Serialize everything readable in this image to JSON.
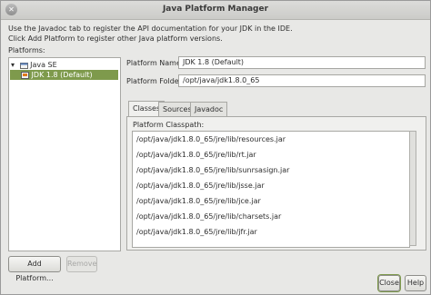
{
  "window": {
    "title": "Java Platform Manager"
  },
  "intro": [
    "Use the Javadoc tab to register the API documentation for your JDK in the IDE.",
    "Click Add Platform to register other Java platform versions."
  ],
  "platforms": {
    "label": "Platforms:",
    "tree": [
      {
        "label": "Java SE",
        "icon": "folder-icon",
        "selected": false
      },
      {
        "label": "JDK 1.8 (Default)",
        "icon": "jdk-icon",
        "selected": true
      }
    ]
  },
  "form": {
    "name_label": "Platform Name:",
    "name_value": "JDK 1.8 (Default)",
    "folder_label": "Platform Folder:",
    "folder_value": "/opt/java/jdk1.8.0_65"
  },
  "tabs": [
    {
      "label": "Classes",
      "active": true
    },
    {
      "label": "Sources",
      "active": false
    },
    {
      "label": "Javadoc",
      "active": false
    }
  ],
  "classpath": {
    "label": "Platform Classpath:",
    "items": [
      "/opt/java/jdk1.8.0_65/jre/lib/resources.jar",
      "/opt/java/jdk1.8.0_65/jre/lib/rt.jar",
      "/opt/java/jdk1.8.0_65/jre/lib/sunrsasign.jar",
      "/opt/java/jdk1.8.0_65/jre/lib/jsse.jar",
      "/opt/java/jdk1.8.0_65/jre/lib/jce.jar",
      "/opt/java/jdk1.8.0_65/jre/lib/charsets.jar",
      "/opt/java/jdk1.8.0_65/jre/lib/jfr.jar"
    ]
  },
  "buttons": {
    "add_platform": "Add Platform...",
    "remove": "Remove",
    "close": "Close",
    "help": "Help"
  },
  "colors": {
    "selection": "#7e9a4c"
  }
}
